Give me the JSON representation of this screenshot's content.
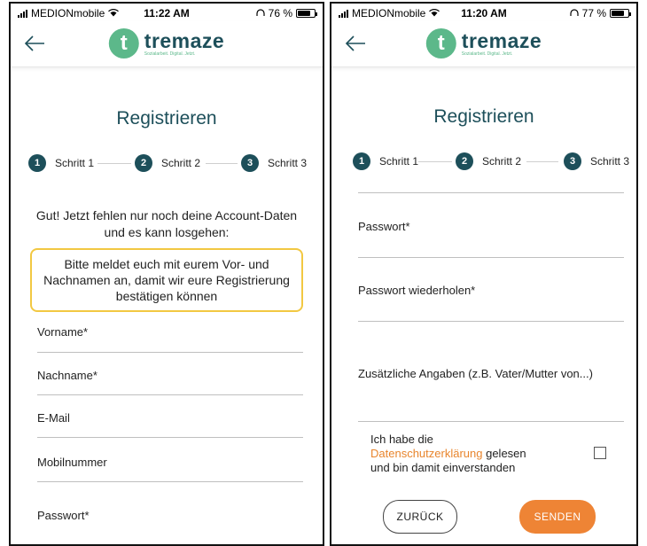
{
  "screen1": {
    "status": {
      "carrier": "MEDIONmobile",
      "time": "11:22 AM",
      "battery": "76 %",
      "battery_level": 0.76
    },
    "logo": {
      "letter": "t",
      "name": "tremaze",
      "tagline": "Sozialarbeit. Digital. Jetzt."
    },
    "title": "Registrieren",
    "steps": [
      {
        "num": "1",
        "label": "Schritt 1"
      },
      {
        "num": "2",
        "label": "Schritt 2"
      },
      {
        "num": "3",
        "label": "Schritt 3"
      }
    ],
    "intro": "Gut! Jetzt fehlen nur noch deine Account-Daten und es kann losgehen:",
    "notice": "Bitte meldet euch mit eurem Vor- und Nachnamen an, damit wir eure Registrierung bestätigen können",
    "fields": {
      "firstname": "Vorname*",
      "lastname": "Nachname*",
      "email": "E-Mail",
      "mobile": "Mobilnummer",
      "password": "Passwort*"
    }
  },
  "screen2": {
    "status": {
      "carrier": "MEDIONmobile",
      "time": "11:20 AM",
      "battery": "77 %",
      "battery_level": 0.77
    },
    "logo": {
      "letter": "t",
      "name": "tremaze",
      "tagline": "Sozialarbeit. Digital. Jetzt."
    },
    "title": "Registrieren",
    "steps": [
      {
        "num": "1",
        "label": "Schritt 1"
      },
      {
        "num": "2",
        "label": "Schritt 2"
      },
      {
        "num": "3",
        "label": "Schritt 3"
      }
    ],
    "fields": {
      "password": "Passwort*",
      "password_repeat": "Passwort wiederholen*",
      "additional": "Zusätzliche Angaben (z.B. Vater/Mutter von...)"
    },
    "consent": {
      "prefix": "Ich habe die",
      "link": "Datenschutzerklärung",
      "suffix_1": "gelesen",
      "suffix_2": "und bin damit einverstanden"
    },
    "buttons": {
      "back": "ZURÜCK",
      "send": "SENDEN"
    }
  },
  "colors": {
    "brand_dark": "#1d4f5a",
    "brand_green": "#5cb88a",
    "accent_orange": "#ee8435",
    "notice_border": "#f2c842"
  }
}
